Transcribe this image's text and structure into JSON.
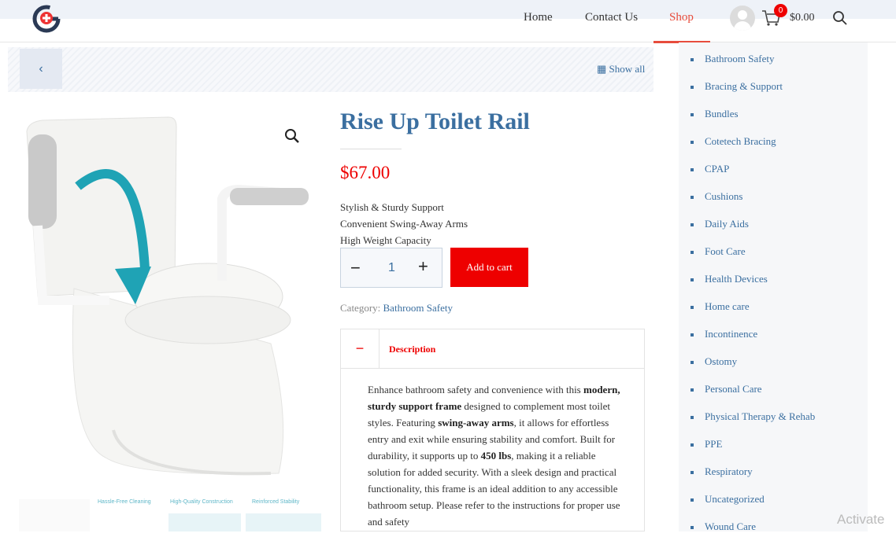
{
  "nav": {
    "home": "Home",
    "contact": "Contact Us",
    "shop": "Shop"
  },
  "cart": {
    "count": "0",
    "total": "$0.00"
  },
  "breadcrumb": {
    "back_icon": "‹",
    "show_all": "Show all"
  },
  "product": {
    "title": "Rise Up Toilet Rail",
    "price": "$67.00",
    "features": [
      "Stylish & Sturdy Support",
      "Convenient Swing-Away Arms",
      "High Weight Capacity"
    ],
    "quantity": "1",
    "add_to_cart": "Add to cart",
    "category_label": "Category:",
    "category_value": "Bathroom Safety"
  },
  "tabs": {
    "description_label": "Description",
    "description_html_parts": {
      "p1": "Enhance bathroom safety and convenience with this ",
      "b1": "modern, sturdy support frame",
      "p2": " designed to complement most toilet styles. Featuring ",
      "b2": "swing-away arms",
      "p3": ", it allows for effortless entry and exit while ensuring stability and comfort. Built for durability, it supports up to ",
      "b3": "450 lbs",
      "p4": ", making it a reliable solution for added security. With a sleek design and practical functionality, this frame is an ideal addition to any accessible bathroom setup. Please refer to the instructions for proper use and safety"
    }
  },
  "thumbnails": {
    "t1": "Hassle-Free Cleaning",
    "t2": "High-Quality Construction",
    "t3": "Reinforced Stability"
  },
  "sidebar": {
    "categories": [
      "Bathroom Safety",
      "Bracing & Support",
      "Bundles",
      "Cotetech Bracing",
      "CPAP",
      "Cushions",
      "Daily Aids",
      "Foot Care",
      "Health Devices",
      "Home care",
      "Incontinence",
      "Ostomy",
      "Personal Care",
      "Physical Therapy & Rehab",
      "PPE",
      "Respiratory",
      "Uncategorized",
      "Wound Care"
    ]
  },
  "watermark": "Activate",
  "colors": {
    "accent_red": "#e00000",
    "link_blue": "#3b6fa0"
  }
}
